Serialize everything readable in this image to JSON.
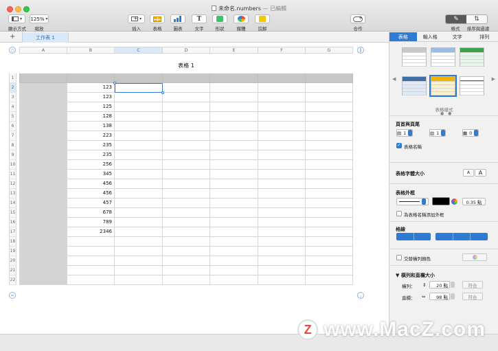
{
  "window": {
    "title": "未命名.numbers",
    "status": "— 已編輯"
  },
  "toolbar": {
    "view_label": "顯示方式",
    "zoom_value": "125%",
    "zoom_label": "縮放",
    "insert_label": "插入",
    "table_label": "表格",
    "chart_label": "圖表",
    "text_label": "文字",
    "shape_label": "形狀",
    "media_label": "媒體",
    "comment_label": "註解",
    "collab_label": "合作",
    "format_label": "格式",
    "sort_label": "排序與過濾"
  },
  "sheets": {
    "add": "+",
    "tabs": [
      "工作表 1"
    ]
  },
  "table": {
    "title": "表格 1",
    "columns": [
      "A",
      "B",
      "C",
      "D",
      "E",
      "F",
      "G"
    ],
    "selected_column": "C",
    "rows": [
      "1",
      "2",
      "3",
      "4",
      "5",
      "6",
      "7",
      "8",
      "9",
      "10",
      "11",
      "12",
      "13",
      "14",
      "15",
      "16",
      "17",
      "18",
      "19",
      "20",
      "21",
      "22"
    ],
    "selected_row": "2",
    "column_b_values": [
      "",
      "123",
      "123",
      "125",
      "128",
      "138",
      "223",
      "235",
      "235",
      "256",
      "345",
      "456",
      "456",
      "457",
      "678",
      "789",
      "2346",
      "",
      "",
      "",
      "",
      ""
    ]
  },
  "inspector": {
    "tabs": [
      "表格",
      "輸入格",
      "文字",
      "排列"
    ],
    "active_tab": "表格",
    "styles_label": "表格樣式",
    "headers_footers": {
      "title": "頁首與頁尾",
      "header_rows": "1",
      "header_cols": "1",
      "footer_rows": "0"
    },
    "table_name_checkbox": "表格名稱",
    "font_size": {
      "title": "表格字體大小",
      "smaller": "A",
      "larger": "A"
    },
    "outline": {
      "title": "表格外框",
      "width": "0.35 點",
      "name_outline_label": "為表格名稱添加外框"
    },
    "gridlines_title": "格線",
    "alternating_label": "交替橫列顏色",
    "rows_cols": {
      "title": "橫列和直欄大小",
      "row_label": "橫列：",
      "row_value": "20 點",
      "col_label": "直欄：",
      "col_value": "98 點",
      "fit_label": "符合"
    }
  },
  "watermark": {
    "logo": "Z",
    "text": "www.MacZ.com"
  },
  "colors": {
    "accent": "#2e7bd6",
    "header_fill": "#c7c7c7",
    "selection": "#dbe8f8"
  }
}
